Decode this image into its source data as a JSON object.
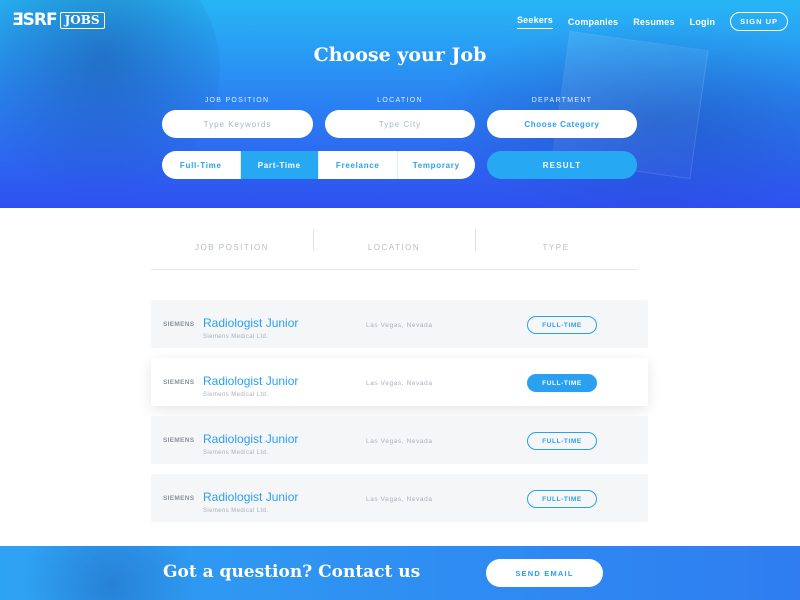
{
  "brand": {
    "mark": "ƎSRF",
    "badge": "JOBS"
  },
  "nav": {
    "items": [
      {
        "label": "Seekers",
        "active": true
      },
      {
        "label": "Companies",
        "active": false
      },
      {
        "label": "Resumes",
        "active": false
      },
      {
        "label": "Login",
        "active": false
      }
    ],
    "signup": "SIGN UP"
  },
  "hero": {
    "title": "Choose your Job",
    "fields": {
      "position": {
        "label": "JOB POSITION",
        "placeholder": "Type Keywords"
      },
      "location": {
        "label": "LOCATION",
        "placeholder": "Type City"
      },
      "department": {
        "label": "DEPARTMENT",
        "value": "Choose Category"
      }
    },
    "types": [
      "Full-Time",
      "Part-Time",
      "Freelance",
      "Temporary"
    ],
    "active_type": "Part-Time",
    "result_button": "RESULT"
  },
  "table": {
    "headers": [
      "JOB POSITION",
      "LOCATION",
      "TYPE"
    ],
    "rows": [
      {
        "company": "SIEMENS",
        "title": "Radiologist Junior",
        "subtitle": "Siemens Medical Ltd.",
        "location": "Las Vegas, Nevada",
        "type": "FULL-TIME",
        "highlight": false
      },
      {
        "company": "SIEMENS",
        "title": "Radiologist Junior",
        "subtitle": "Siemens Medical Ltd.",
        "location": "Las Vegas, Nevada",
        "type": "FULL-TIME",
        "highlight": true
      },
      {
        "company": "SIEMENS",
        "title": "Radiologist Junior",
        "subtitle": "Siemens Medical Ltd.",
        "location": "Las Vegas, Nevada",
        "type": "FULL-TIME",
        "highlight": false
      },
      {
        "company": "SIEMENS",
        "title": "Radiologist Junior",
        "subtitle": "Siemens Medical Ltd.",
        "location": "Las Vegas, Nevada",
        "type": "FULL-TIME",
        "highlight": false
      }
    ]
  },
  "footer": {
    "text": "Got a question? Contact us",
    "button": "SEND EMAIL"
  },
  "colors": {
    "accent": "#2aa0f0",
    "hero_top": "#27b6f5",
    "hero_bottom": "#2f4ff0",
    "row_bg": "#f5f6f8"
  }
}
